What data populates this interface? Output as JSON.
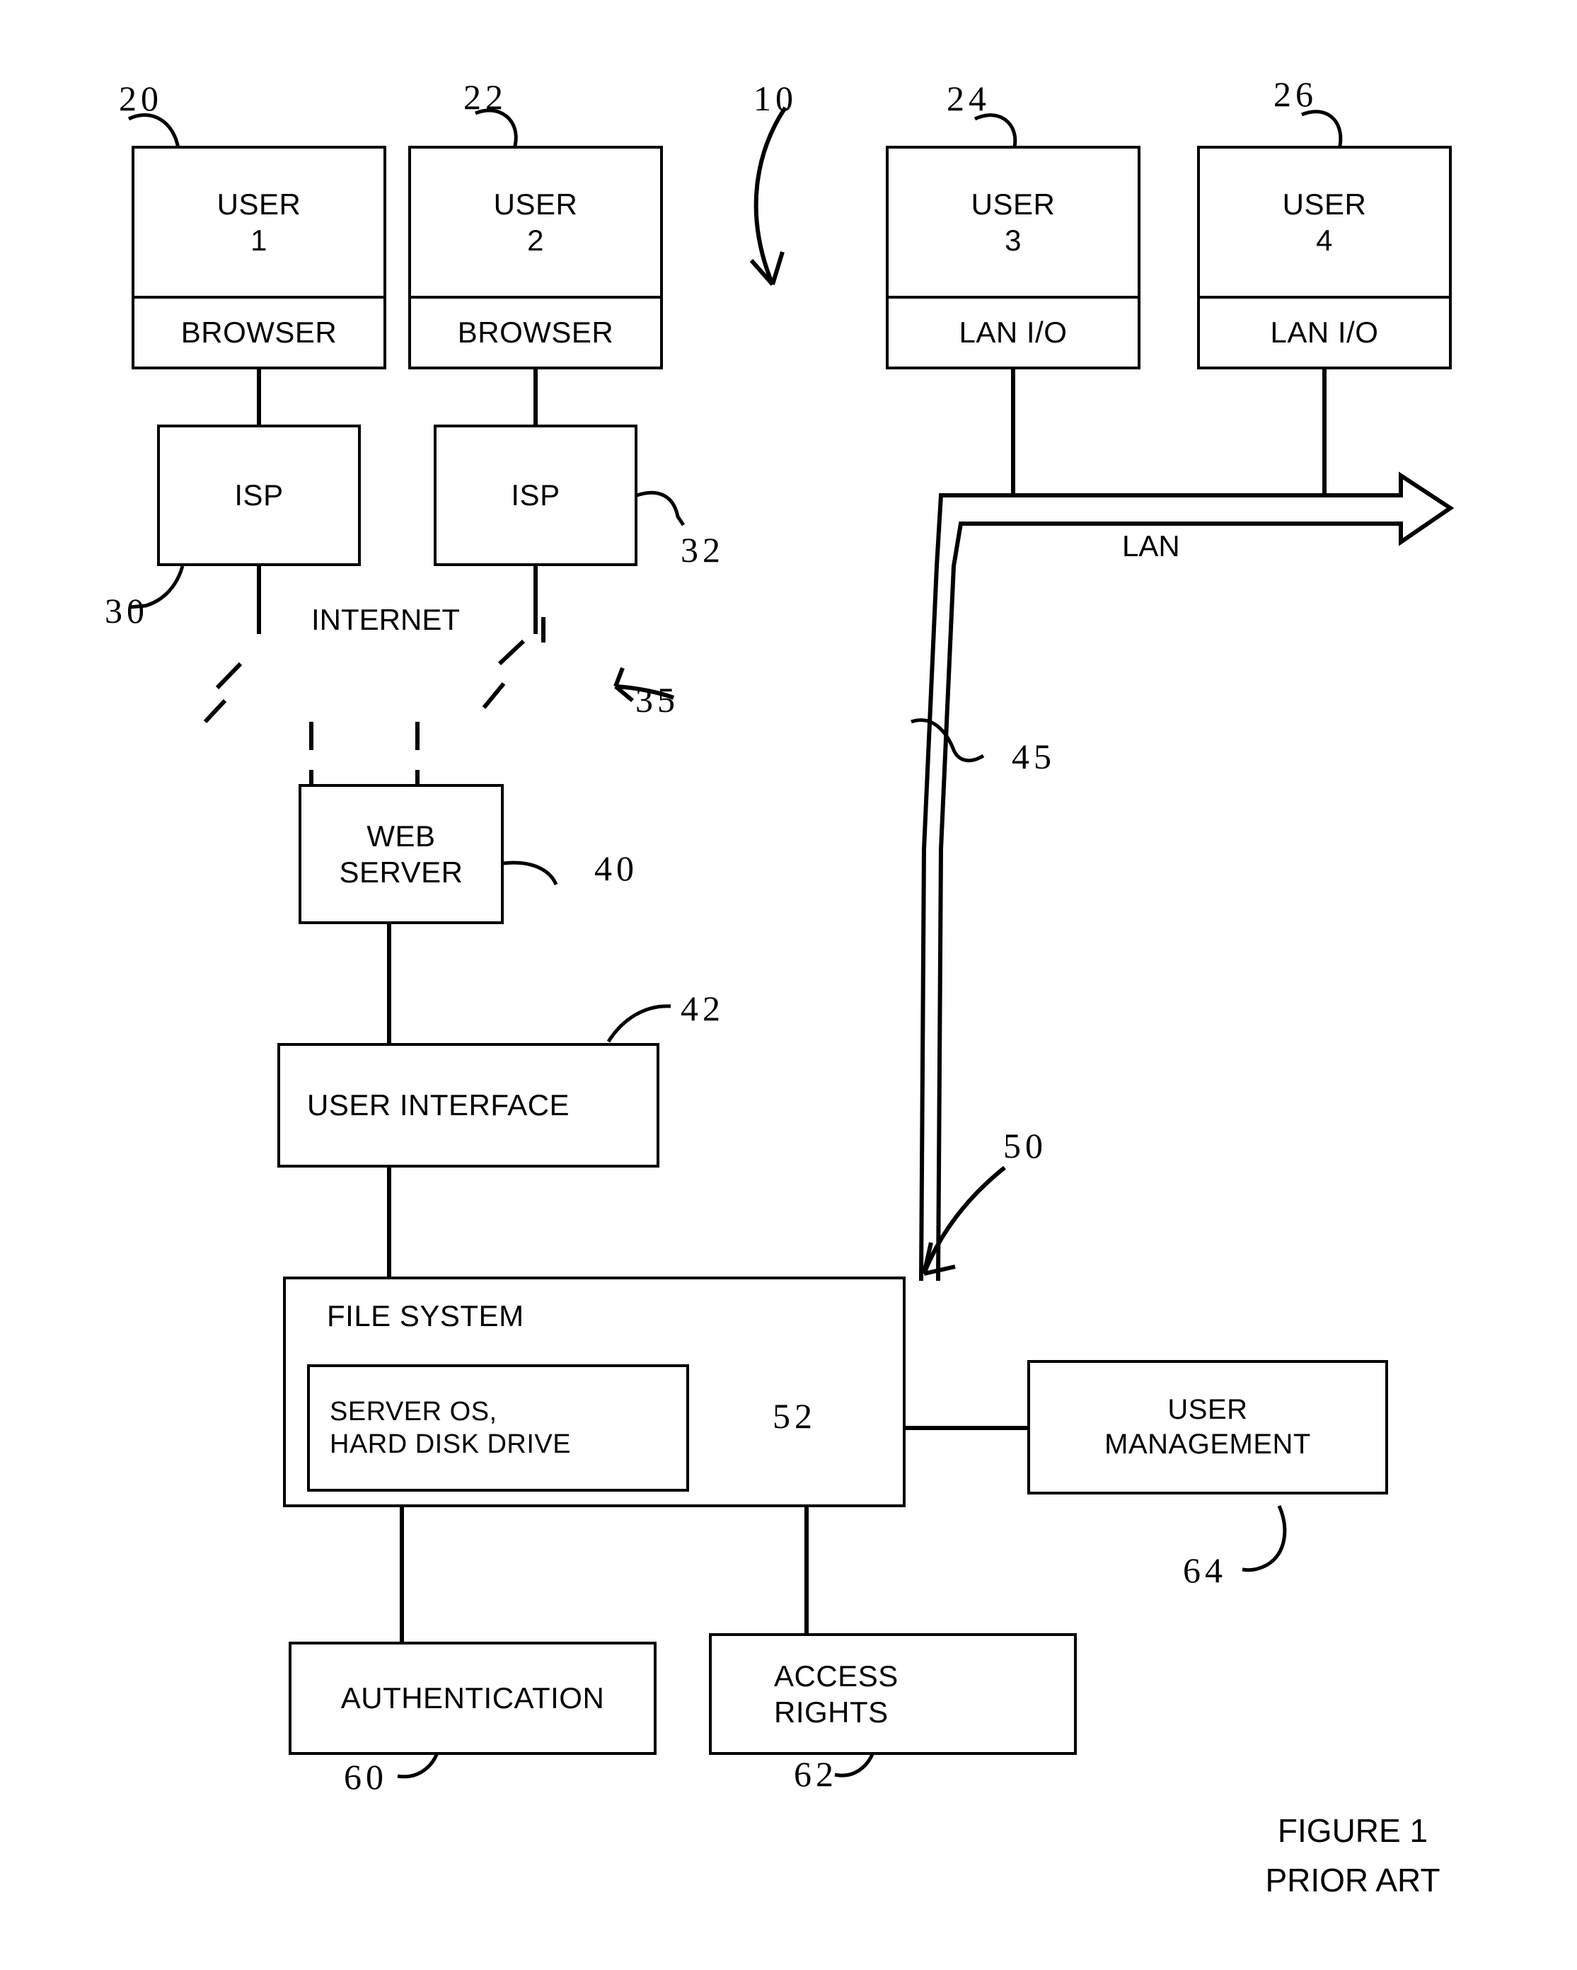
{
  "figure": {
    "caption_line1": "FIGURE 1",
    "caption_line2": "PRIOR ART",
    "system_ref": "10"
  },
  "nodes": {
    "user1": {
      "title": "USER\n1",
      "sub": "BROWSER",
      "ref": "20"
    },
    "user2": {
      "title": "USER\n2",
      "sub": "BROWSER",
      "ref": "22"
    },
    "user3": {
      "title": "USER\n3",
      "sub": "LAN I/O",
      "ref": "24"
    },
    "user4": {
      "title": "USER\n4",
      "sub": "LAN I/O",
      "ref": "26"
    },
    "isp1": {
      "label": "ISP",
      "ref": "30"
    },
    "isp2": {
      "label": "ISP",
      "ref": "32"
    },
    "internet": {
      "label": "INTERNET",
      "ref": "35"
    },
    "lan": {
      "label": "LAN",
      "ref": "45"
    },
    "web_server": {
      "label": "WEB\nSERVER",
      "ref": "40"
    },
    "user_interface": {
      "label": "USER INTERFACE",
      "ref": "42"
    },
    "file_system": {
      "label": "FILE SYSTEM",
      "ref": "50"
    },
    "server_os": {
      "label": "SERVER OS,\nHARD DISK DRIVE",
      "ref": "52"
    },
    "user_management": {
      "label": "USER\nMANAGEMENT",
      "ref": "64"
    },
    "authentication": {
      "label": "AUTHENTICATION",
      "ref": "60"
    },
    "access_rights": {
      "label": "ACCESS\nRIGHTS",
      "ref": "62"
    }
  },
  "colors": {
    "ink": "#000000",
    "paper": "#ffffff"
  }
}
